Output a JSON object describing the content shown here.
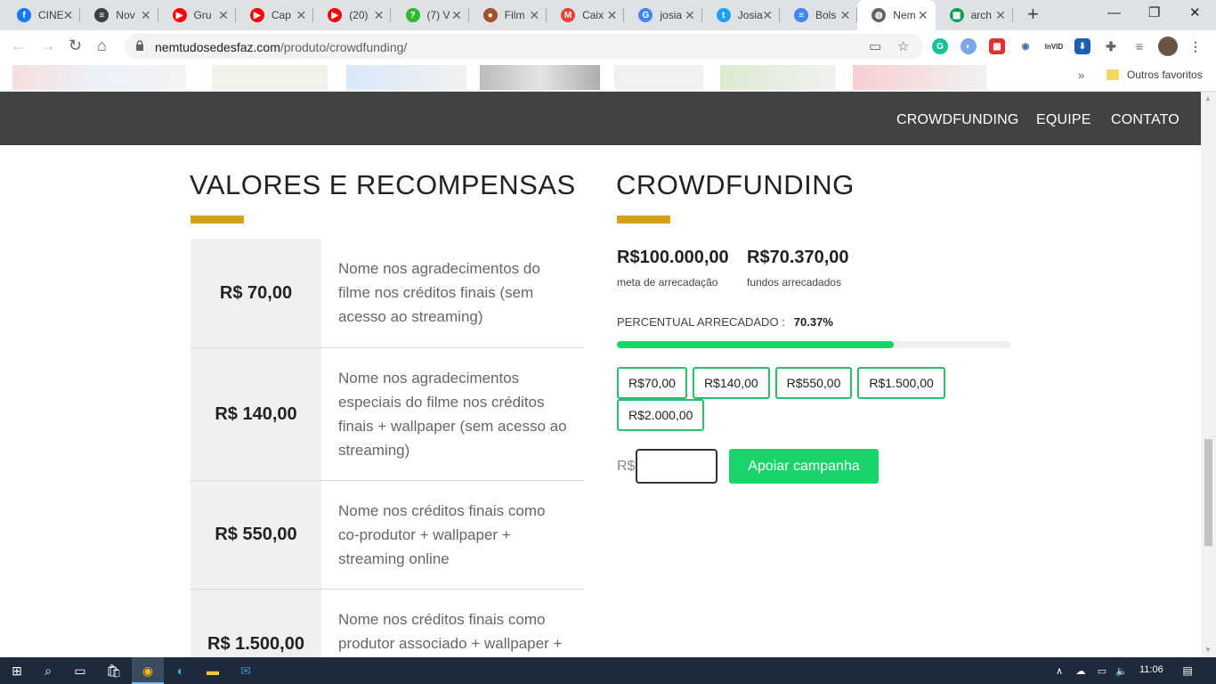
{
  "tabs": [
    {
      "title": "CINE",
      "icon": "facebook-icon",
      "color": "#1877f2",
      "glyph": "f"
    },
    {
      "title": "Nov",
      "icon": "document-lines-icon",
      "color": "#3c4043",
      "glyph": "≡"
    },
    {
      "title": "Gru",
      "icon": "youtube-icon",
      "color": "#ff0000",
      "glyph": "▶"
    },
    {
      "title": "Cap",
      "icon": "youtube-icon",
      "color": "#ff0000",
      "glyph": "▶"
    },
    {
      "title": "(20)",
      "icon": "youtube-icon",
      "color": "#ff0000",
      "glyph": "▶"
    },
    {
      "title": "(7) V",
      "icon": "green-question-icon",
      "color": "#2eb82e",
      "glyph": "?"
    },
    {
      "title": "Film",
      "icon": "film-reel-icon",
      "color": "#a0522d",
      "glyph": "●"
    },
    {
      "title": "Caix",
      "icon": "gmail-icon",
      "color": "#ea4335",
      "glyph": "M"
    },
    {
      "title": "josia",
      "icon": "google-icon",
      "color": "#4285f4",
      "glyph": "G"
    },
    {
      "title": "Josia",
      "icon": "twitter-icon",
      "color": "#1da1f2",
      "glyph": "t"
    },
    {
      "title": "Bols",
      "icon": "google-docs-icon",
      "color": "#4285f4",
      "glyph": "≡"
    },
    {
      "title": "Nem",
      "icon": "globe-icon",
      "color": "#5f6368",
      "glyph": "◍"
    },
    {
      "title": "arch",
      "icon": "sheet-icon",
      "color": "#0f9d58",
      "glyph": "▦"
    }
  ],
  "address": {
    "host": "nemtudosedesfaz.com",
    "path": "/produto/crowdfunding/"
  },
  "bookmarks": {
    "other_favorites": "Outros favoritos"
  },
  "nav": {
    "crowdfunding": "CROWDFUNDING",
    "team": "EQUIPE",
    "contact": "CONTATO"
  },
  "rewards": {
    "title": "VALORES E RECOMPENSAS",
    "items": [
      {
        "price": "R$ 70,00",
        "desc": "Nome nos agradecimentos do filme nos créditos finais (sem acesso ao streaming)"
      },
      {
        "price": "R$ 140,00",
        "desc": "Nome nos agradecimentos especiais do filme nos créditos finais + wallpaper (sem acesso ao streaming)"
      },
      {
        "price": "R$ 550,00",
        "desc": "Nome nos créditos finais como co-produtor + wallpaper + streaming online"
      },
      {
        "price": "R$ 1.500,00",
        "desc": "Nome nos créditos finais como produtor associado + wallpaper +"
      }
    ]
  },
  "crowdfunding": {
    "title": "CROWDFUNDING",
    "goal_value": "R$100.000,00",
    "goal_label": "meta de arrecadação",
    "raised_value": "R$70.370,00",
    "raised_label": "fundos arrecadados",
    "percent_label": "PERCENTUAL ARRECADADO :",
    "percent_value": "70.37%",
    "progress": 0.7037,
    "amounts": [
      "R$70,00",
      "R$140,00",
      "R$550,00",
      "R$1.500,00"
    ],
    "amount_row2": "R$2.000,00",
    "currency": "R$",
    "support_button": "Apoiar campanha"
  },
  "taskbar": {
    "time": "11:06"
  }
}
